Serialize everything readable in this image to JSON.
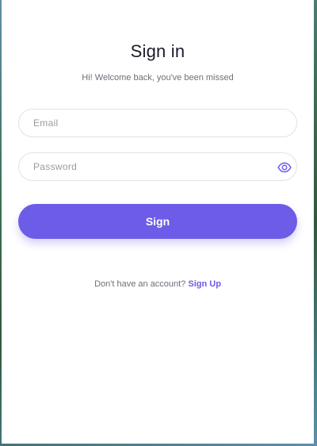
{
  "signin": {
    "title": "Sign in",
    "subtitle": "Hi! Welcome back, you've been missed",
    "email_placeholder": "Email",
    "password_placeholder": "Password",
    "submit_label": "Sign",
    "footer_text": "Don't have an account?",
    "signup_label": "Sign Up"
  },
  "colors": {
    "accent": "#6c5ce7",
    "title": "#1c1c2b",
    "muted": "#6e6e78",
    "border": "#e2e2e6"
  },
  "icons": {
    "password_toggle": "eye-icon"
  }
}
